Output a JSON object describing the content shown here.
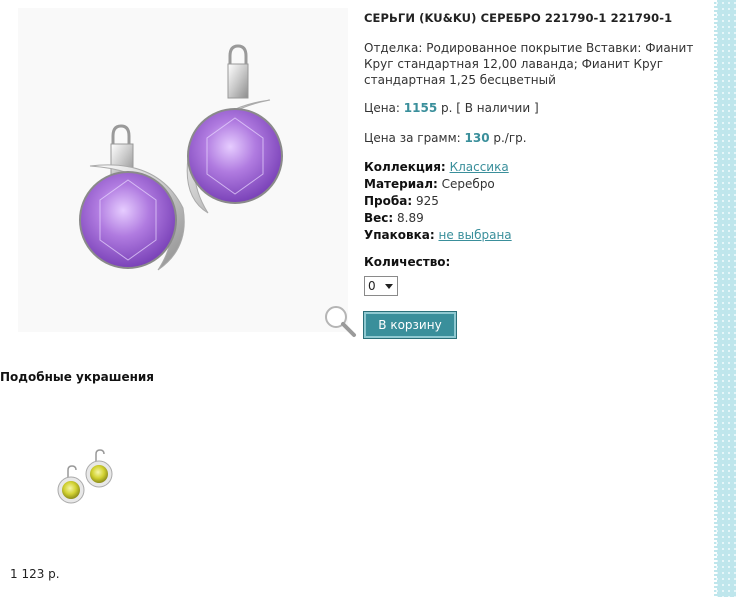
{
  "product": {
    "title": "СЕРЬГИ (KU&KU) СЕРЕБРО 221790-1 221790-1",
    "description": "Отделка: Родированное покрытие Вставки: Фианит Круг стандартная 12,00 лаванда; Фианит Круг стандартная 1,25 бесцветный",
    "price_label": "Цена: ",
    "price_value": "1155",
    "price_unit": " р. [ В наличии ]",
    "gram_label": "Цена за грамм: ",
    "gram_value": "130",
    "gram_unit": " р./гр.",
    "collection_key": "Коллекция:",
    "collection_val": "Классика",
    "material_key": "Материал:",
    "material_val": "Серебро",
    "probe_key": "Проба:",
    "probe_val": "925",
    "weight_key": "Вес:",
    "weight_val": "8.89",
    "pack_key": "Упаковка:",
    "pack_val": "не выбрана",
    "qty_label": "Количество:",
    "qty_value": "0",
    "cart_button": "В корзину",
    "colors": {
      "accent": "#3a8f9b",
      "gem": "#a36fd6",
      "strip": "#bfe6ec"
    }
  },
  "similar": {
    "title": "Подобные украшения",
    "items": [
      {
        "price": "1 123 р.",
        "gem_color": "#d9d93a"
      }
    ]
  },
  "icons": {
    "zoom": "magnifier-icon"
  }
}
